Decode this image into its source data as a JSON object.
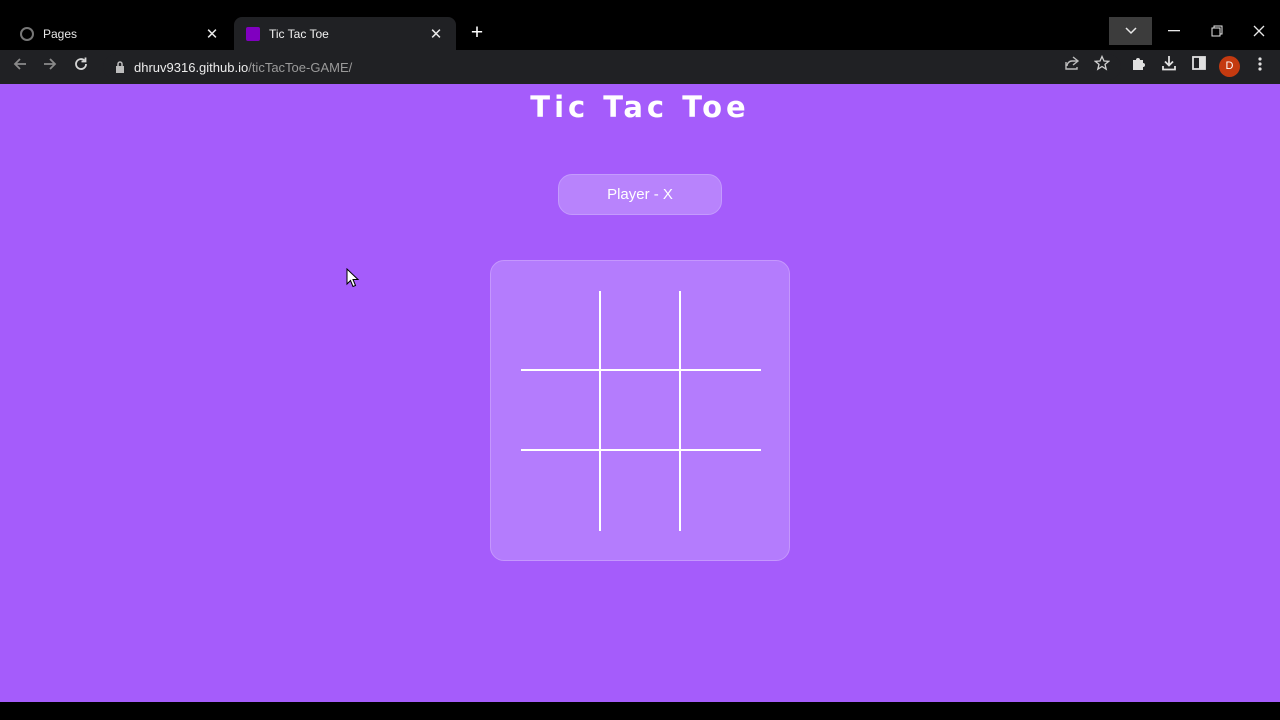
{
  "browser": {
    "tabs": [
      {
        "title": "Pages",
        "icon": "github-icon",
        "active": false
      },
      {
        "title": "Tic Tac Toe",
        "icon": "purple-square-icon",
        "active": true
      }
    ],
    "url_host": "dhruv9316.github.io",
    "url_path": "/ticTacToe-GAME/",
    "profile_initial": "D"
  },
  "page": {
    "title": "Tic Tac Toe",
    "player_label": "Player - X",
    "board": [
      "",
      "",
      "",
      "",
      "",
      "",
      "",
      "",
      ""
    ]
  },
  "colors": {
    "page_background": "#a55cfb",
    "card_background": "#b47cfd",
    "grid_lines": "#ffffff",
    "profile_avatar": "#c43a10"
  }
}
